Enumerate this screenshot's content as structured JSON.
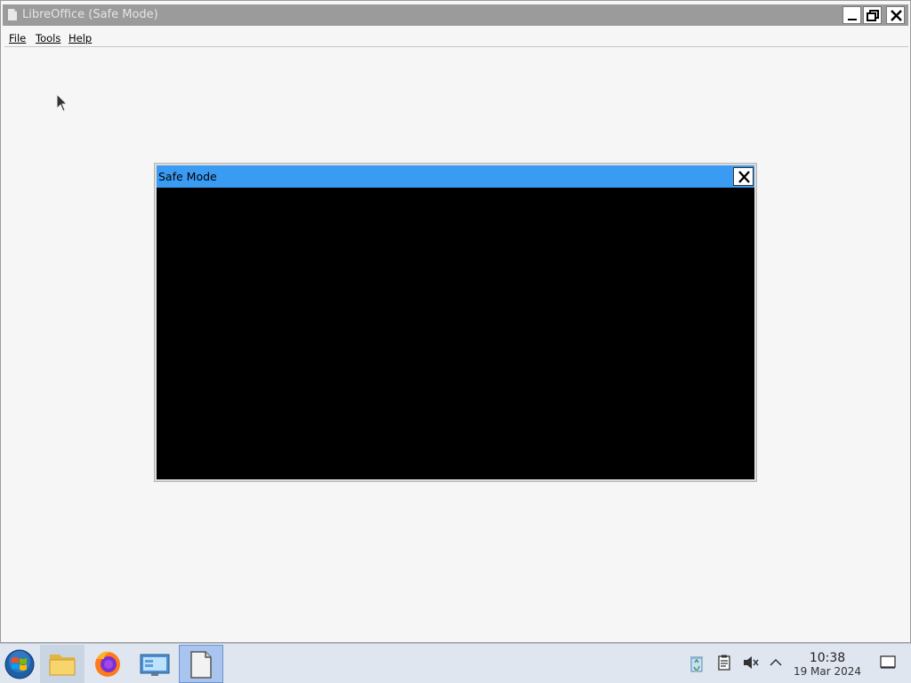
{
  "window": {
    "title": "LibreOffice (Safe Mode)"
  },
  "menu": [
    {
      "label": "File"
    },
    {
      "label": "Tools"
    },
    {
      "label": "Help"
    }
  ],
  "dialog": {
    "title": "Safe Mode"
  },
  "taskbar": {
    "apps": [
      {
        "name": "start-button",
        "icon": "windows-orb-icon"
      },
      {
        "name": "file-manager",
        "icon": "folder-icon"
      },
      {
        "name": "firefox",
        "icon": "firefox-icon"
      },
      {
        "name": "control-panel",
        "icon": "monitor-icon"
      },
      {
        "name": "libreoffice",
        "icon": "document-icon"
      }
    ],
    "tray": {
      "icons": [
        "recycle-bin-icon",
        "clipboard-icon",
        "muted-speaker-icon",
        "chevron-up-icon",
        "show-desktop-icon"
      ]
    },
    "clock": {
      "time": "10:38",
      "date": "19 Mar 2024"
    }
  },
  "colors": {
    "dialog_titlebar": "#3a9bf3",
    "window_titlebar": "#9b9b9b",
    "taskbar": "#dfe6ef",
    "active_task": "#a9c4ee"
  }
}
